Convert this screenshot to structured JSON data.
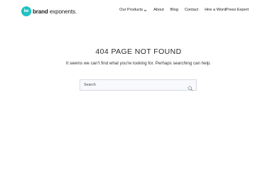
{
  "header": {
    "logo": {
      "badge": "be",
      "brand": "brand",
      "rest": " exponents."
    },
    "nav": [
      {
        "label": "Our Products",
        "has_dropdown": true
      },
      {
        "label": "About"
      },
      {
        "label": "Blog"
      },
      {
        "label": "Contact"
      },
      {
        "label": "Hire a WordPress Expert"
      }
    ]
  },
  "main": {
    "title": "404 PAGE NOT FOUND",
    "message": "It seems we can't find what you're looking for. Perhaps searching can help."
  },
  "search": {
    "placeholder": "Search",
    "icon": "search-icon"
  },
  "colors": {
    "accent": "#1fc2c2",
    "input_border": "#d8dbe3",
    "input_bg": "#f8f9fc"
  }
}
